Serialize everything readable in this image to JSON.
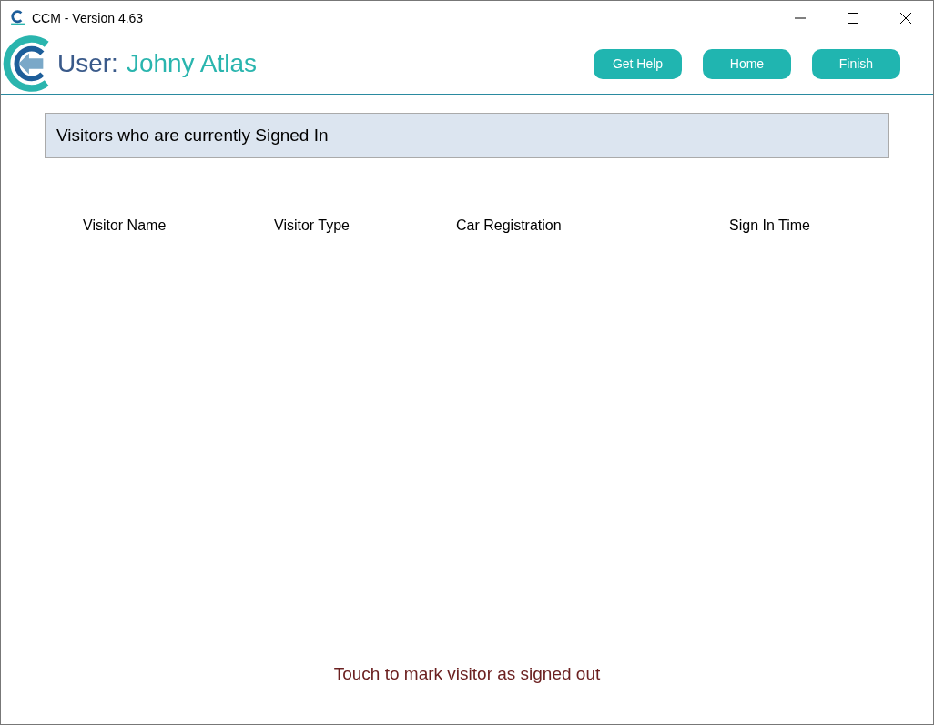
{
  "window": {
    "title": "CCM - Version 4.63"
  },
  "header": {
    "user_label": "User:",
    "user_name": "Johny Atlas",
    "buttons": [
      "Get Help",
      "Home",
      "Finish"
    ]
  },
  "panel": {
    "title": "Visitors who are currently Signed In"
  },
  "table": {
    "columns": [
      "Visitor Name",
      "Visitor Type",
      "Car Registration",
      "Sign In Time"
    ]
  },
  "footer": {
    "hint": "Touch to mark visitor as signed out"
  }
}
